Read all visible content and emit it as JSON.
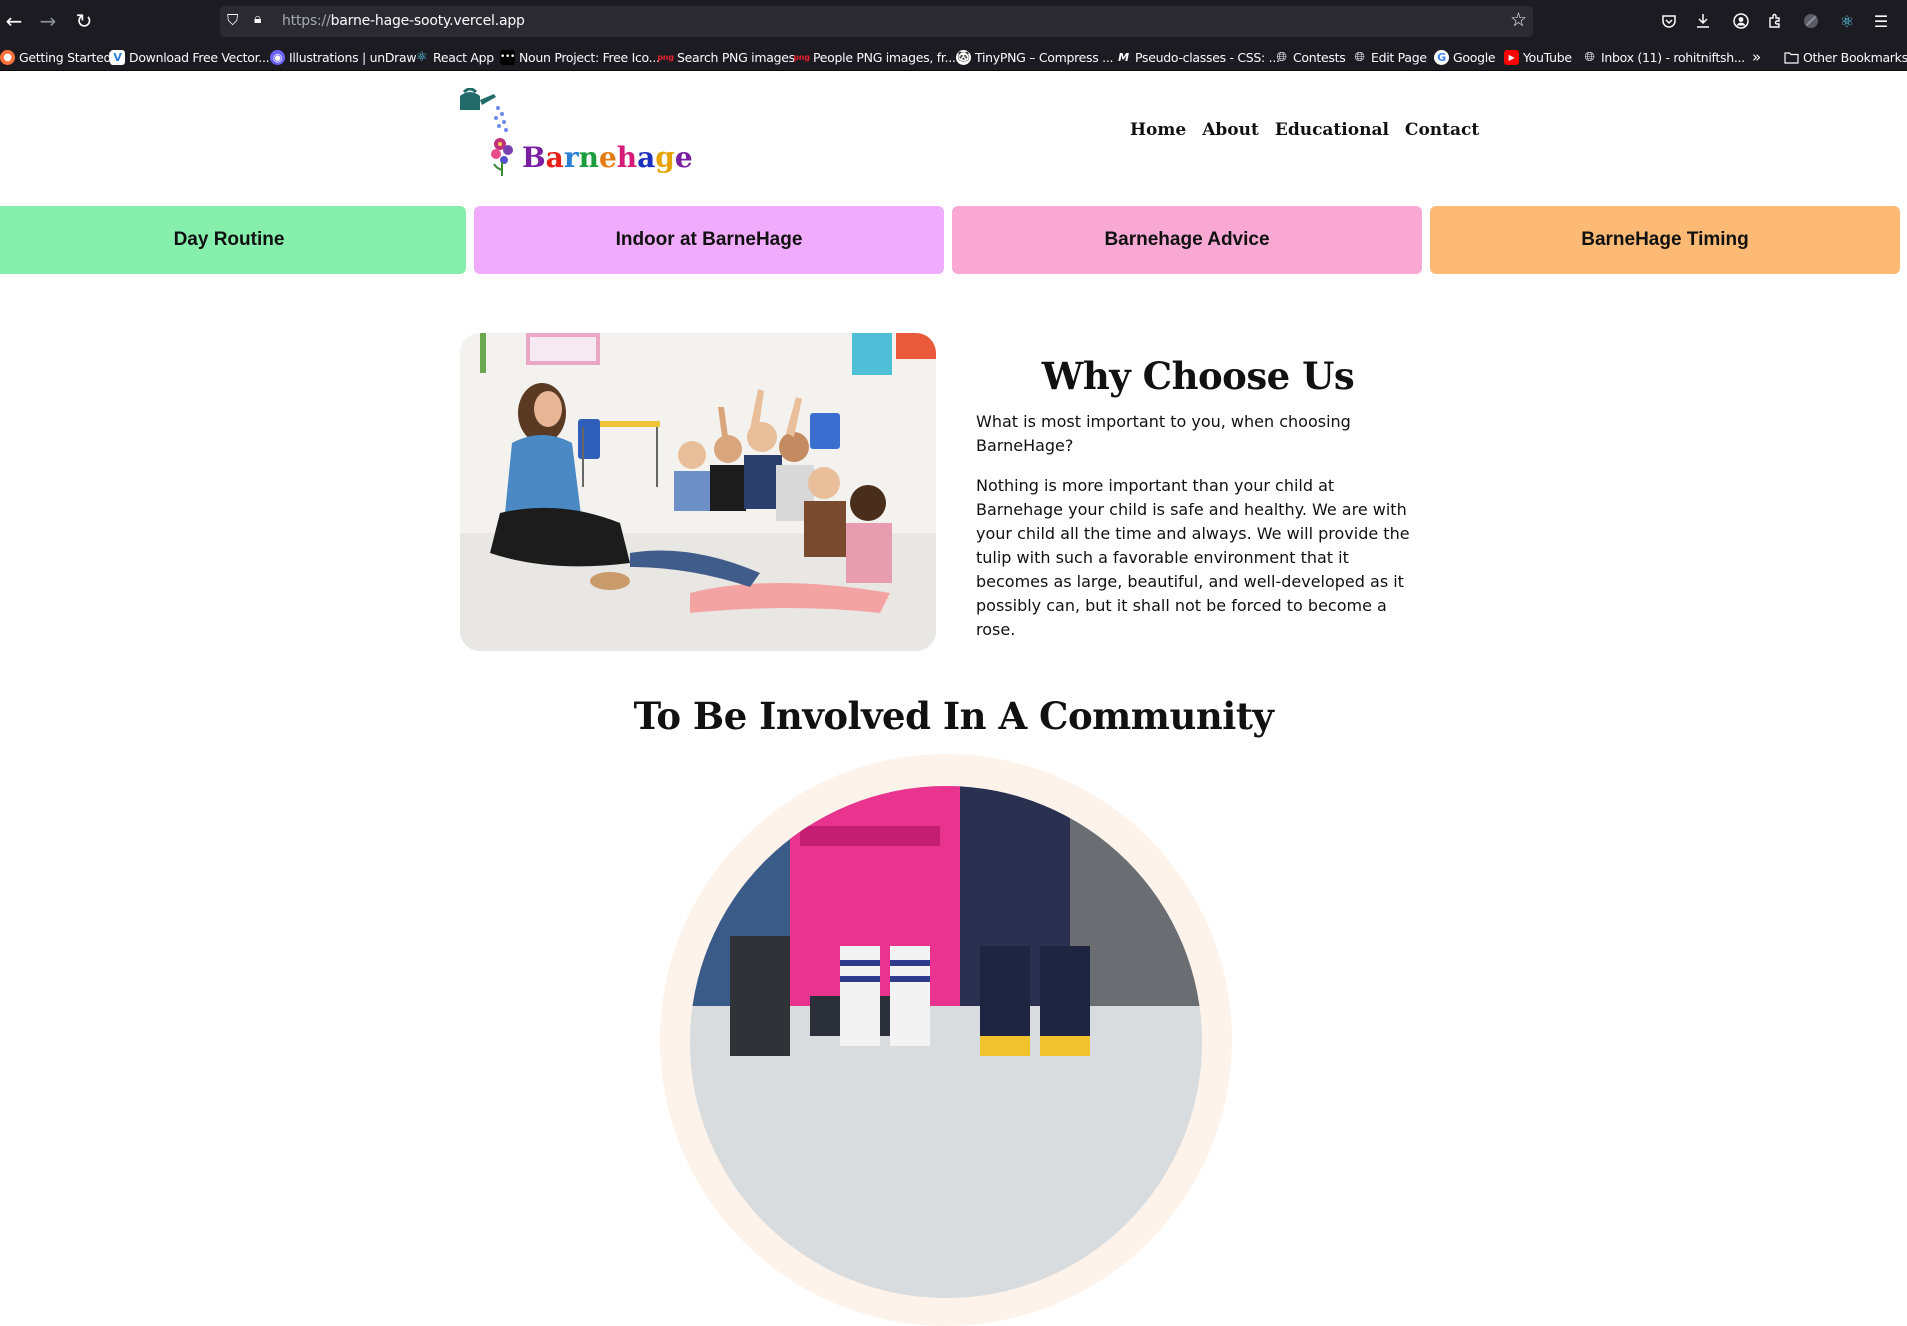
{
  "browser": {
    "url_scheme": "https://",
    "url_host": "barne-hage-sooty.vercel.app",
    "bookmarks": [
      {
        "label": "Getting Started",
        "icon": "firefox-icon"
      },
      {
        "label": "Download Free Vector...",
        "icon": "vector-icon"
      },
      {
        "label": "Illustrations | unDraw",
        "icon": "undraw-icon"
      },
      {
        "label": "React App",
        "icon": "react-icon"
      },
      {
        "label": "Noun Project: Free Ico...",
        "icon": "noun-project-icon"
      },
      {
        "label": "Search PNG images",
        "icon": "png-icon"
      },
      {
        "label": "People PNG images, fr...",
        "icon": "png-icon"
      },
      {
        "label": "TinyPNG – Compress ...",
        "icon": "tinypng-icon"
      },
      {
        "label": "Pseudo-classes - CSS: ...",
        "icon": "mdn-icon"
      },
      {
        "label": "Contests",
        "icon": "globe-icon"
      },
      {
        "label": "Edit Page",
        "icon": "globe-icon"
      },
      {
        "label": "Google",
        "icon": "google-icon"
      },
      {
        "label": "YouTube",
        "icon": "youtube-icon"
      },
      {
        "label": "Inbox (11) - rohitniftsh...",
        "icon": "globe-icon"
      }
    ],
    "overflow_label": "»",
    "other_bookmarks_label": "Other Bookmarks"
  },
  "site": {
    "logo_text": "Barnehage",
    "logo_letter_colors": [
      "#7a1fa2",
      "#e8201a",
      "#2a7fd6",
      "#1b9d3b",
      "#e47b12",
      "#d81b7a",
      "#1c2fbf",
      "#e6a300",
      "#7a1fa2"
    ],
    "nav": [
      "Home",
      "About",
      "Educational",
      "Contact"
    ]
  },
  "cards": [
    {
      "label": "Day Routine",
      "color": "#86efac"
    },
    {
      "label": "Indoor at BarneHage",
      "color": "#f0abfc"
    },
    {
      "label": "Barnehage Advice",
      "color": "#f9a8d4"
    },
    {
      "label": "BarneHage Timing",
      "color": "#fdba74"
    }
  ],
  "why": {
    "title": "Why Choose Us",
    "question": "What is most important to you, when choosing BarneHage?",
    "body": "Nothing is more important than your child at Barnehage your child is safe and healthy. We are with your child all the time and always. We will provide the tulip with such a favorable environment that it becomes as large, beautiful, and well-developed as it possibly can, but it shall not be forced to become a rose."
  },
  "community": {
    "title": "To Be Involved In A Community"
  }
}
